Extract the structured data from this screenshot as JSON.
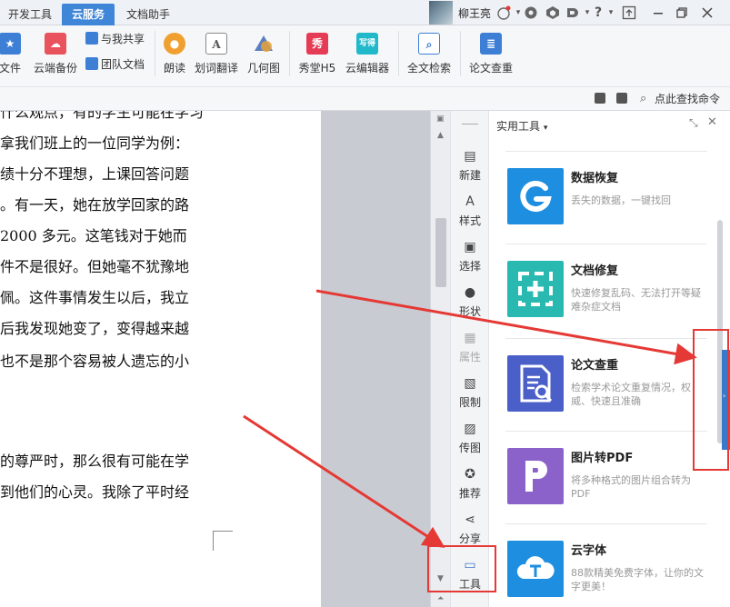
{
  "tabs": [
    {
      "label": "开发工具",
      "active": false
    },
    {
      "label": "云服务",
      "active": true
    },
    {
      "label": "文档助手",
      "active": false
    }
  ],
  "user": {
    "name": "柳王亮"
  },
  "title_controls": {
    "help": "?"
  },
  "ribbon": {
    "items": [
      {
        "label": "文件",
        "icon": "star-file-icon",
        "color": "#3e7fd6"
      },
      {
        "label": "云端备份",
        "icon": "cloud-backup-icon",
        "color": "#e8535d"
      },
      {
        "label": "与我共享",
        "icon": "share-icon",
        "color": "#3e7fd6"
      },
      {
        "label": "团队文档",
        "icon": "team-icon",
        "color": "#3e7fd6"
      },
      {
        "label": "朗读",
        "icon": "microphone-icon",
        "color": "#f0a030"
      },
      {
        "label": "划词翻译",
        "icon": "translate-icon",
        "color": "#555555"
      },
      {
        "label": "几何图",
        "icon": "geometry-icon",
        "color": "#5a7fc0"
      },
      {
        "label": "秀堂H5",
        "icon": "xiutang-icon",
        "glyph": "秀",
        "color": "#e63b54"
      },
      {
        "label": "云编辑器",
        "icon": "cloud-editor-icon",
        "glyph": "写得",
        "color": "#21b8c9"
      },
      {
        "label": "全文检索",
        "icon": "full-search-icon",
        "color": "#3e7fd6"
      },
      {
        "label": "论文查重",
        "icon": "paper-check-icon",
        "color": "#3e7fd6"
      }
    ]
  },
  "subbar": {
    "find_command": "点此查找命令"
  },
  "document": {
    "lines": [
      "，我们班上的一位同学为例：",
      "，她十分不理想，上课回答问题",
      "。有一天，她在放学回家的路",
      "2000 多元。这笔钱对于她而",
      "件不是很好。但她毫不犹豫地",
      "佩。这件事情发生以后，我立",
      "后我发现她变了，变得越来越",
      "也不是那个容易被人遗忘的小",
      "的尊严时，那么很有可能在学",
      "到他们的心灵。我除了平时经"
    ],
    "top_fragment": "什么观点，有的学生可能在学习",
    "line1_full": "拿我们班上的一位同学为例：",
    "line2_full": "绩十分不理想，上课回答问题",
    "line3_full": "。有一天，她在放学回家的路",
    "line4_full": "2000 多元。这笔钱对于她而",
    "line5_full": "件不是很好。但她毫不犹豫地",
    "line6_full": "佩。这件事情发生以后，我立",
    "line7_full": "后我发现她变了，变得越来越",
    "line8_full": "也不是那个容易被人遗忘的小",
    "line9_full": "的尊严时，那么很有可能在学",
    "line10_full": "到他们的心灵。我除了平时经"
  },
  "sidebar": {
    "items": [
      {
        "label": "新建",
        "icon": "new-doc-icon"
      },
      {
        "label": "样式",
        "icon": "style-icon"
      },
      {
        "label": "选择",
        "icon": "select-icon"
      },
      {
        "label": "形状",
        "icon": "shape-icon"
      },
      {
        "label": "属性",
        "icon": "property-icon"
      },
      {
        "label": "限制",
        "icon": "restrict-icon"
      },
      {
        "label": "传图",
        "icon": "upload-image-icon"
      },
      {
        "label": "推荐",
        "icon": "recommend-icon"
      },
      {
        "label": "分享",
        "icon": "share-icon"
      },
      {
        "label": "工具",
        "icon": "toolbox-icon"
      }
    ]
  },
  "panel": {
    "title": "实用工具",
    "cards": [
      {
        "title": "数据恢复",
        "desc": "丢失的数据，一键找回",
        "color": "#1e8fe0"
      },
      {
        "title": "文档修复",
        "desc": "快速修复乱码、无法打开等疑难杂症文档",
        "color": "#2ab9b0"
      },
      {
        "title": "论文查重",
        "desc": "检索学术论文重复情况，权威、快速且准确",
        "color": "#4a5fc7"
      },
      {
        "title": "图片转PDF",
        "desc": "将多种格式的图片组合转为PDF",
        "color": "#8b62c9"
      },
      {
        "title": "云字体",
        "desc": "88款精美免费字体，让你的文字更美！",
        "color": "#1e8fe0"
      }
    ]
  },
  "colors": {
    "accent": "#3f86d8",
    "annotation": "#e53935"
  }
}
